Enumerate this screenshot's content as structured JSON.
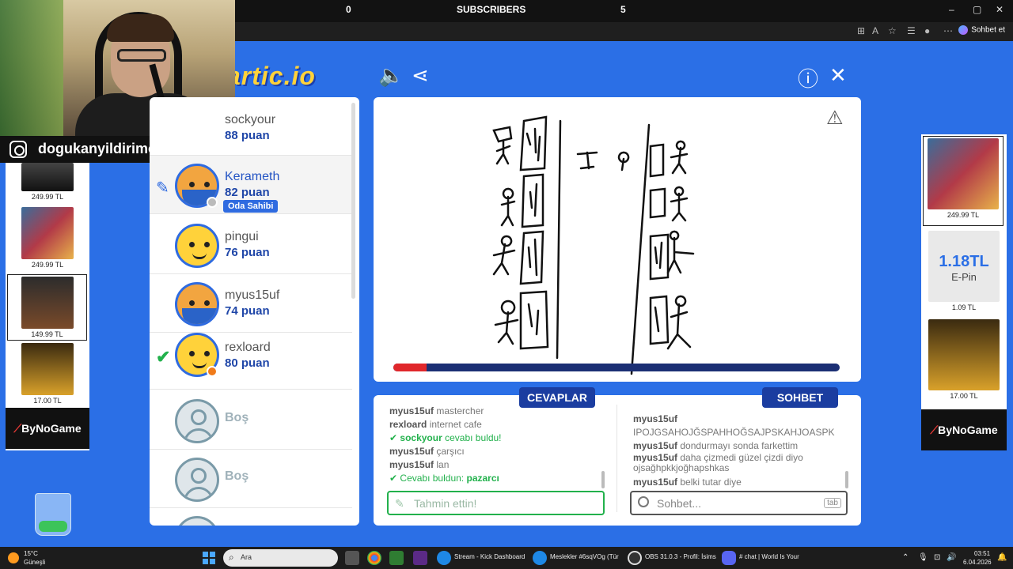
{
  "overlay": {
    "followers_count": "0",
    "subscribers_label": "SUBSCRIBERS",
    "subscribers_count": "5",
    "instagram_handle": "dogukanyildirimofficiall"
  },
  "browser": {
    "copilot_label": "Sohbet et",
    "min": "–",
    "max": "▢",
    "close": "✕"
  },
  "game": {
    "logo": "artic.io",
    "sound_icon": "speaker-icon",
    "share_icon": "share-icon",
    "info_icon": "info-icon",
    "close_icon": "close-icon",
    "progress_fraction": 0.075,
    "colors": {
      "accent": "#2f6be0",
      "brand_yellow": "#ffd23a",
      "correct": "#22b14c",
      "timer": "#e0272b"
    }
  },
  "players": [
    {
      "name": "sockyour",
      "score": "88 puan"
    },
    {
      "name": "Kerameth",
      "score": "82 puan",
      "badge": "Oda Sahibi"
    },
    {
      "name": "pingui",
      "score": "76 puan"
    },
    {
      "name": "myus15uf",
      "score": "74 puan"
    },
    {
      "name": "rexloard",
      "score": "80 puan"
    },
    {
      "name": "Boş"
    },
    {
      "name": "Boş"
    }
  ],
  "tabs": {
    "answers": "CEVAPLAR",
    "chat": "SOHBET"
  },
  "answers": {
    "lines": [
      {
        "user": "myus15uf",
        "text": "mastercher"
      },
      {
        "user": "rexloard",
        "text": "internet cafe"
      },
      {
        "user": "sockyour",
        "text": "cevabı buldu!"
      },
      {
        "user": "myus15uf",
        "text": "çarşıcı"
      },
      {
        "user": "myus15uf",
        "text": "lan"
      },
      {
        "label": "Cevabı buldun:",
        "answer": "pazarcı"
      }
    ],
    "placeholder": "Tahmin ettin!"
  },
  "chat": {
    "lines": [
      {
        "user": "myus15uf",
        "text": "IPOJGSAHOJĞSPAHHOĞSAJPSKAHJOASPK"
      },
      {
        "user": "myus15uf",
        "text": "dondurmayı sonda farkettim"
      },
      {
        "user": "myus15uf",
        "text": "daha çizmedi güzel çizdi diyo ojsağhpkkjoğhapshkas"
      },
      {
        "user": "myus15uf",
        "text": "belki tutar diye"
      }
    ],
    "placeholder": "Sohbet...",
    "tab_hint": "tab"
  },
  "ads_left": [
    {
      "price": "249.99 TL"
    },
    {
      "price": "249.99 TL"
    },
    {
      "price": "149.99 TL"
    },
    {
      "price": "17.00 TL"
    }
  ],
  "ads_right": [
    {
      "price": "249.99 TL"
    },
    {
      "price": "1.09 TL",
      "title": "1.18TL",
      "subtitle": "E-Pin"
    },
    {
      "price": "17.00 TL"
    }
  ],
  "bynogame": "ByNoGame",
  "taskbar": {
    "weather_temp": "15°C",
    "weather_desc": "Güneşli",
    "search": "Ara",
    "apps": [
      "Stream - Kick Dashboard",
      "Meslekler #6sqVOg (Tür",
      "OBS 31.0.3 - Profil: İsims",
      "# chat | World Is Your"
    ],
    "time": "03:51",
    "date": "6.04.2026"
  }
}
